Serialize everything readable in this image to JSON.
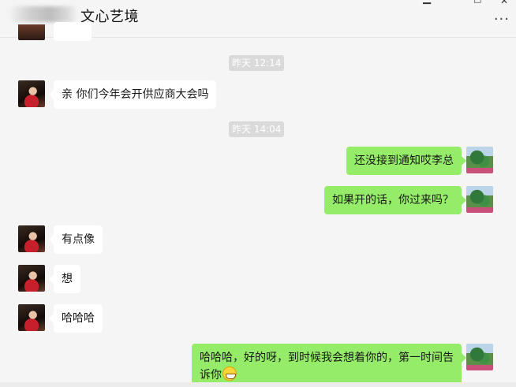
{
  "header": {
    "title": "文心艺境",
    "more_icon": "more-icon"
  },
  "messages": [
    {
      "type": "time",
      "text": "昨天 12:14"
    },
    {
      "type": "incoming",
      "text": "亲 你们今年会开供应商大会吗"
    },
    {
      "type": "time",
      "text": "昨天 14:04"
    },
    {
      "type": "outgoing",
      "text": "还没接到通知哎李总"
    },
    {
      "type": "outgoing",
      "text": "如果开的话，你过来吗？"
    },
    {
      "type": "incoming",
      "text": "有点像"
    },
    {
      "type": "incoming",
      "text": "想"
    },
    {
      "type": "incoming",
      "text": "哈哈哈"
    },
    {
      "type": "outgoing",
      "line1": "哈哈哈，好的呀，到时候我会想着你的，第一时间告",
      "line2": "诉你",
      "emoji": "grin-emoji"
    }
  ],
  "colors": {
    "background": "#f5f5f5",
    "incoming_bubble": "#ffffff",
    "outgoing_bubble": "#95ec69",
    "timestamp_bg": "#dadada"
  }
}
